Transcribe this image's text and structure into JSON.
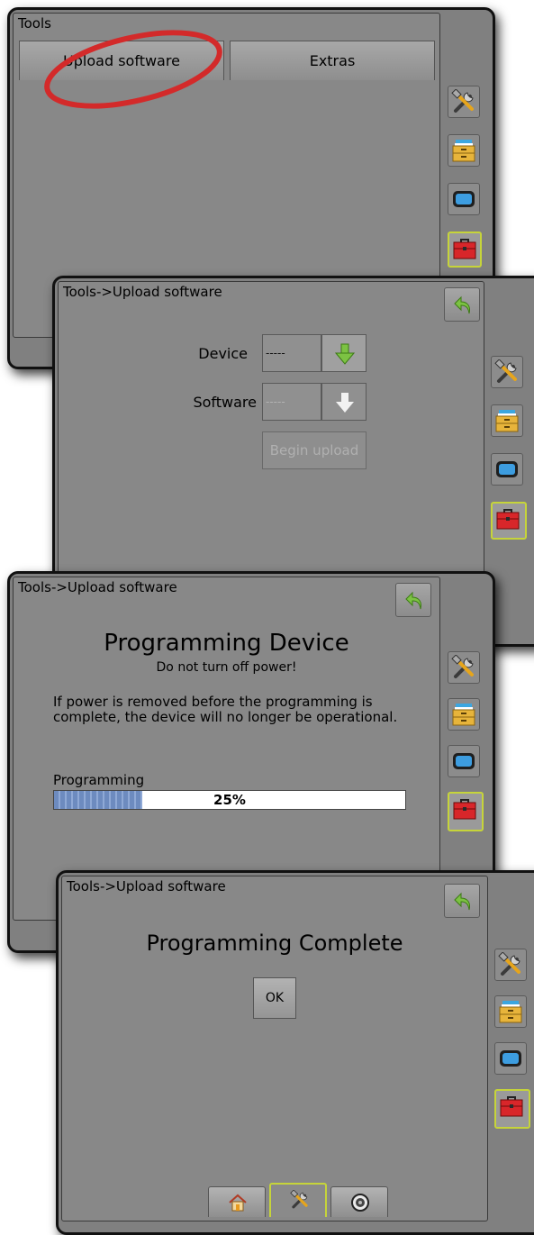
{
  "panel1": {
    "title": "Tools",
    "tabs": [
      {
        "label": "Upload software"
      },
      {
        "label": "Extras"
      }
    ],
    "highlight": "red-ellipse"
  },
  "panel2": {
    "title": "Tools->Upload software",
    "device_label": "Device",
    "device_value": "-----",
    "software_label": "Software",
    "software_value": "-----",
    "begin_label": "Begin upload"
  },
  "panel3": {
    "title": "Tools->Upload software",
    "heading": "Programming Device",
    "subheading": "Do not turn off power!",
    "warning": "If power is removed before the programming is complete, the device will no longer be operational.",
    "progress_label": "Programming",
    "progress_text": "25%",
    "progress_fraction": 0.25
  },
  "panel4": {
    "title": "Tools->Upload software",
    "heading": "Programming Complete",
    "ok_label": "OK"
  },
  "sidebar_icons": [
    "tools-icon",
    "data-drawer-icon",
    "display-icon",
    "toolbox-icon"
  ],
  "bottom_tabs": [
    "home-icon",
    "tools-icon",
    "gauge-icon"
  ],
  "colors": {
    "panel_gray": "#888888",
    "active_outline": "#c6d43a",
    "back_arrow_green": "#7cc243",
    "highlight_red": "#d32a2a",
    "progress_blue": "#7594c8"
  }
}
